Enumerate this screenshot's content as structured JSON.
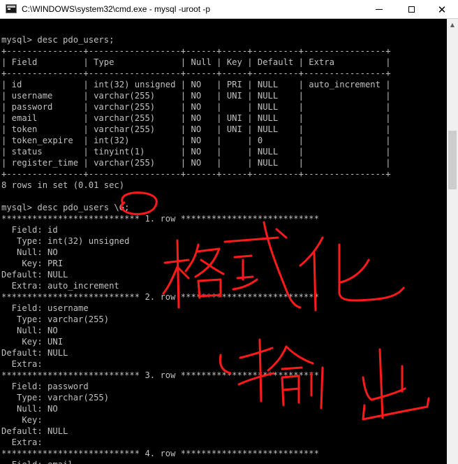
{
  "window": {
    "title": "C:\\WINDOWS\\system32\\cmd.exe - mysql  -uroot -p",
    "minimize_glyph": "minimize",
    "maximize_glyph": "maximize",
    "close_glyph": "✕"
  },
  "colors": {
    "console_text": "#c0c0c0",
    "console_bg": "#000000",
    "annotation": "#ff0000"
  },
  "console": {
    "lines": [
      "",
      "mysql> desc pdo_users;",
      "+---------------+------------------+------+-----+---------+----------------+",
      "| Field         | Type             | Null | Key | Default | Extra          |",
      "+---------------+------------------+------+-----+---------+----------------+",
      "| id            | int(32) unsigned | NO   | PRI | NULL    | auto_increment |",
      "| username      | varchar(255)     | NO   | UNI | NULL    |                |",
      "| password      | varchar(255)     | NO   |     | NULL    |                |",
      "| email         | varchar(255)     | NO   | UNI | NULL    |                |",
      "| token         | varchar(255)     | NO   | UNI | NULL    |                |",
      "| token_expire  | int(32)          | NO   |     | 0       |                |",
      "| status        | tinyint(1)       | NO   |     | NULL    |                |",
      "| register_time | varchar(255)     | NO   |     | NULL    |                |",
      "+---------------+------------------+------+-----+---------+----------------+",
      "8 rows in set (0.01 sec)",
      "",
      "mysql> desc pdo_users \\G;",
      "*************************** 1. row ***************************",
      "  Field: id",
      "   Type: int(32) unsigned",
      "   Null: NO",
      "    Key: PRI",
      "Default: NULL",
      "  Extra: auto_increment",
      "*************************** 2. row ***************************",
      "  Field: username",
      "   Type: varchar(255)",
      "   Null: NO",
      "    Key: UNI",
      "Default: NULL",
      "  Extra:",
      "*************************** 3. row ***************************",
      "  Field: password",
      "   Type: varchar(255)",
      "   Null: NO",
      "    Key:",
      "Default: NULL",
      "  Extra:",
      "*************************** 4. row ***************************",
      "  Field: email"
    ]
  },
  "annotation": {
    "text_line1": "格式化",
    "text_line2": "输出"
  }
}
